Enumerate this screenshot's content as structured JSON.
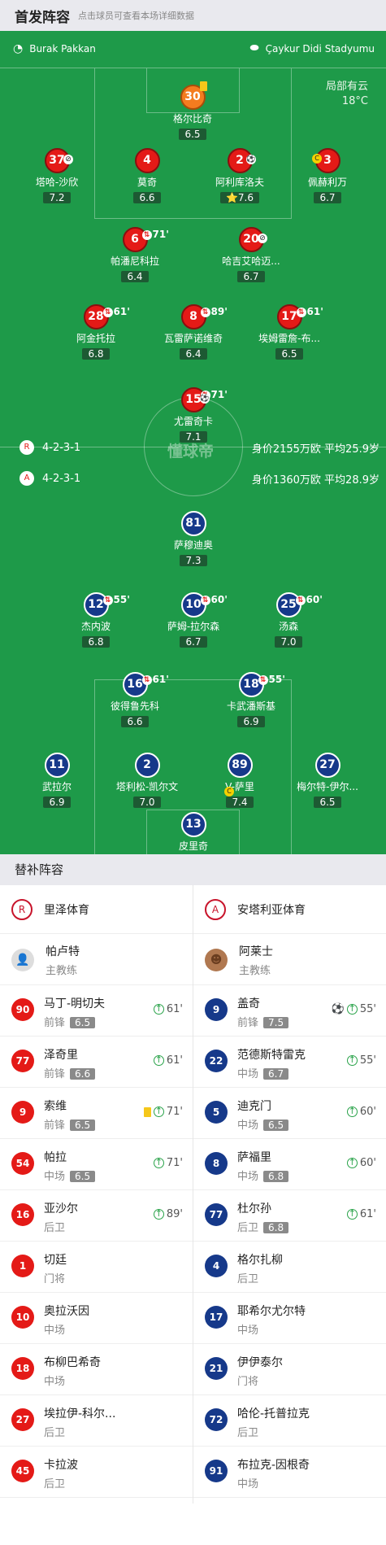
{
  "header": {
    "title": "首发阵容",
    "subtitle": "点击球员可查看本场详细数据"
  },
  "pitch_info": {
    "referee": "Burak Pakkan",
    "venue": "Çaykur Didi Stadyumu",
    "weather_line1": "局部有云",
    "weather_line2": "18°C"
  },
  "home_team": {
    "formation": "4-2-3-1",
    "value_line": "身价2155万欧  平均25.9岁"
  },
  "away_team": {
    "formation": "4-2-3-1",
    "value_line": "身价1360万欧  平均28.9岁"
  },
  "home_players": [
    {
      "num": "30",
      "name": "格尔比奇",
      "rating": "6.5",
      "style": "o",
      "card": "yellow"
    },
    {
      "num": "37",
      "name": "塔哈-沙欣",
      "rating": "7.2",
      "style": "r"
    },
    {
      "num": "4",
      "name": "莫奇",
      "rating": "6.6",
      "style": "r"
    },
    {
      "num": "2",
      "name": "阿利库洛夫",
      "rating": "7.6",
      "style": "r",
      "star": "⭐"
    },
    {
      "num": "3",
      "name": "佩赫利万",
      "rating": "6.7",
      "style": "r"
    },
    {
      "num": "6",
      "name": "帕潘尼科拉",
      "rating": "6.4",
      "style": "r",
      "sub": "71'"
    },
    {
      "num": "20",
      "name": "哈吉艾哈迈...",
      "rating": "6.7",
      "style": "r"
    },
    {
      "num": "28",
      "name": "阿金托拉",
      "rating": "6.8",
      "style": "r",
      "sub": "61'"
    },
    {
      "num": "8",
      "name": "瓦雷萨诺维奇",
      "rating": "6.4",
      "style": "r",
      "sub": "89'"
    },
    {
      "num": "17",
      "name": "埃姆雷詹-布...",
      "rating": "6.5",
      "style": "r",
      "sub": "61'"
    },
    {
      "num": "15",
      "name": "尤雷奇卡",
      "rating": "7.1",
      "style": "r",
      "sub": "71'"
    }
  ],
  "away_players": [
    {
      "num": "81",
      "name": "萨穆迪奥",
      "rating": "7.3"
    },
    {
      "num": "12",
      "name": "杰内波",
      "rating": "6.8",
      "sub": "55'"
    },
    {
      "num": "10",
      "name": "萨姆-拉尔森",
      "rating": "6.7",
      "sub": "60'"
    },
    {
      "num": "25",
      "name": "汤森",
      "rating": "7.0",
      "sub": "60'"
    },
    {
      "num": "16",
      "name": "彼得鲁先科",
      "rating": "6.6",
      "sub": "61'"
    },
    {
      "num": "18",
      "name": "卡武潘斯基",
      "rating": "6.9",
      "sub": "55'"
    },
    {
      "num": "11",
      "name": "武拉尔",
      "rating": "6.9"
    },
    {
      "num": "2",
      "name": "塔利松-凯尔文",
      "rating": "7.0"
    },
    {
      "num": "89",
      "name": "V-萨里",
      "rating": "7.4"
    },
    {
      "num": "27",
      "name": "梅尔特-伊尔...",
      "rating": "6.5"
    },
    {
      "num": "13",
      "name": "皮里奇",
      "rating": "6.3"
    }
  ],
  "subs_header": "替补阵容",
  "home_bench": {
    "team_name": "里泽体育",
    "team_logo": "R",
    "coach_name": "帕卢特",
    "coach_role": "主教练",
    "players": [
      {
        "num": "90",
        "name": "马丁-明切夫",
        "pos": "前锋",
        "rating": "6.5",
        "event": "61'"
      },
      {
        "num": "77",
        "name": "泽奇里",
        "pos": "前锋",
        "rating": "6.6",
        "event": "61'"
      },
      {
        "num": "9",
        "name": "索维",
        "pos": "前锋",
        "rating": "6.5",
        "event": "71'"
      },
      {
        "num": "54",
        "name": "帕拉",
        "pos": "中场",
        "rating": "6.5",
        "event": "71'"
      },
      {
        "num": "16",
        "name": "亚沙尔",
        "pos": "后卫",
        "rating": "",
        "event": "89'"
      },
      {
        "num": "1",
        "name": "切廷",
        "pos": "门将",
        "rating": "",
        "event": ""
      },
      {
        "num": "10",
        "name": "奥拉沃因",
        "pos": "中场",
        "rating": "",
        "event": ""
      },
      {
        "num": "18",
        "name": "布柳巴希奇",
        "pos": "中场",
        "rating": "",
        "event": ""
      },
      {
        "num": "27",
        "name": "埃拉伊-科尔...",
        "pos": "后卫",
        "rating": "",
        "event": ""
      },
      {
        "num": "45",
        "name": "卡拉波",
        "pos": "后卫",
        "rating": "",
        "event": ""
      }
    ]
  },
  "away_bench": {
    "team_name": "安塔利亚体育",
    "team_logo": "A",
    "coach_name": "阿莱士",
    "coach_role": "主教练",
    "players": [
      {
        "num": "9",
        "name": "盖奇",
        "pos": "前锋",
        "rating": "7.5",
        "event": "55'"
      },
      {
        "num": "22",
        "name": "范德斯特雷克",
        "pos": "中场",
        "rating": "6.7",
        "event": "55'"
      },
      {
        "num": "5",
        "name": "迪克门",
        "pos": "中场",
        "rating": "6.5",
        "event": "60'"
      },
      {
        "num": "8",
        "name": "萨福里",
        "pos": "中场",
        "rating": "6.8",
        "event": "60'"
      },
      {
        "num": "77",
        "name": "杜尔孙",
        "pos": "后卫",
        "rating": "6.8",
        "event": "61'"
      },
      {
        "num": "4",
        "name": "格尔扎柳",
        "pos": "后卫",
        "rating": "",
        "event": ""
      },
      {
        "num": "17",
        "name": "耶希尔尤尔特",
        "pos": "中场",
        "rating": "",
        "event": ""
      },
      {
        "num": "21",
        "name": "伊伊泰尔",
        "pos": "门将",
        "rating": "",
        "event": ""
      },
      {
        "num": "72",
        "name": "哈伦-托普拉克",
        "pos": "后卫",
        "rating": "",
        "event": ""
      },
      {
        "num": "91",
        "name": "布拉克-因根奇",
        "pos": "中场",
        "rating": "",
        "event": ""
      }
    ]
  },
  "watermark": "懂球帝"
}
